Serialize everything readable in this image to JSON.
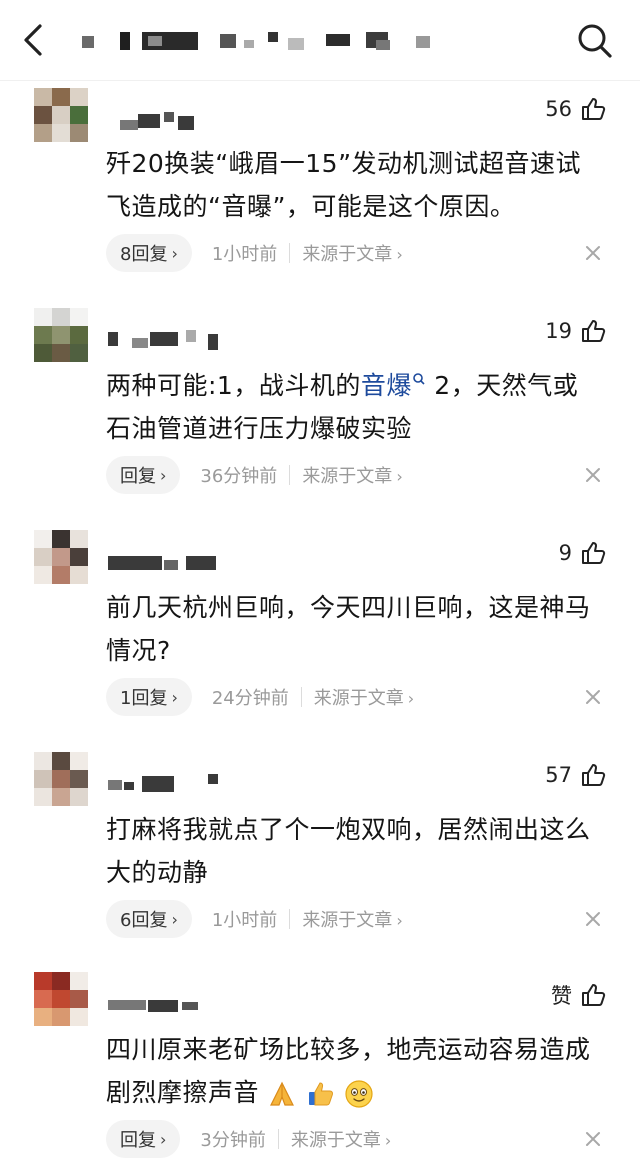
{
  "header": {
    "back_icon": "chevron-left-icon",
    "search_icon": "search-icon",
    "title_mosaic": ""
  },
  "comments": [
    {
      "likes": "56",
      "text_lines": [
        "歼20换装“峨眉一15”发动机测试超音速试",
        "飞造成的“音曝”，可能是这个原因。"
      ],
      "reply": "8回复",
      "time": "1小时前",
      "source": "来源于文章"
    },
    {
      "likes": "19",
      "text_a": "两种可能:1，战斗机的",
      "link": "音爆",
      "text_b": " 2，天然气或",
      "text_line2": "石油管道进行压力爆破实验",
      "reply": "回复",
      "time": "36分钟前",
      "source": "来源于文章"
    },
    {
      "likes": "9",
      "text_lines": [
        "前几天杭州巨响，今天四川巨响，这是神马",
        "情况?"
      ],
      "reply": "1回复",
      "time": "24分钟前",
      "source": "来源于文章"
    },
    {
      "likes": "57",
      "text_lines": [
        "打麻将我就点了个一炮双响，居然闹出这么",
        "大的动静"
      ],
      "reply": "6回复",
      "time": "1小时前",
      "source": "来源于文章"
    },
    {
      "likes": "赞",
      "text_lines": [
        "四川原来老矿场比较多，地壳运动容易造成",
        "剧烈摩擦声音"
      ],
      "reply": "回复",
      "time": "3分钟前",
      "source": "来源于文章"
    }
  ],
  "colors": {
    "link": "#1d4a9c",
    "muted": "#9a9a9a",
    "pill_bg": "#f3f3f3"
  }
}
